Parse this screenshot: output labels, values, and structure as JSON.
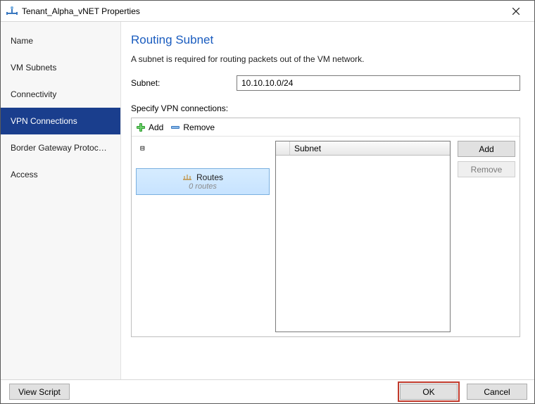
{
  "window": {
    "title": "Tenant_Alpha_vNET Properties"
  },
  "sidebar": {
    "items": [
      {
        "label": "Name"
      },
      {
        "label": "VM Subnets"
      },
      {
        "label": "Connectivity"
      },
      {
        "label": "VPN Connections"
      },
      {
        "label": "Border Gateway Protocol..."
      },
      {
        "label": "Access"
      }
    ]
  },
  "content": {
    "section_title": "Routing Subnet",
    "hint": "A subnet is required for routing packets out of the VM network.",
    "subnet_label": "Subnet:",
    "subnet_value": "10.10.10.0/24",
    "specify_label": "Specify VPN connections:",
    "toolbar": {
      "add": "Add",
      "remove": "Remove"
    },
    "tree": {
      "toggle": "⊟",
      "routes_label": "Routes",
      "routes_count": "0 routes"
    },
    "grid": {
      "column": "Subnet",
      "buttons": {
        "add": "Add",
        "remove": "Remove"
      }
    }
  },
  "footer": {
    "view_script": "View Script",
    "ok": "OK",
    "cancel": "Cancel"
  }
}
